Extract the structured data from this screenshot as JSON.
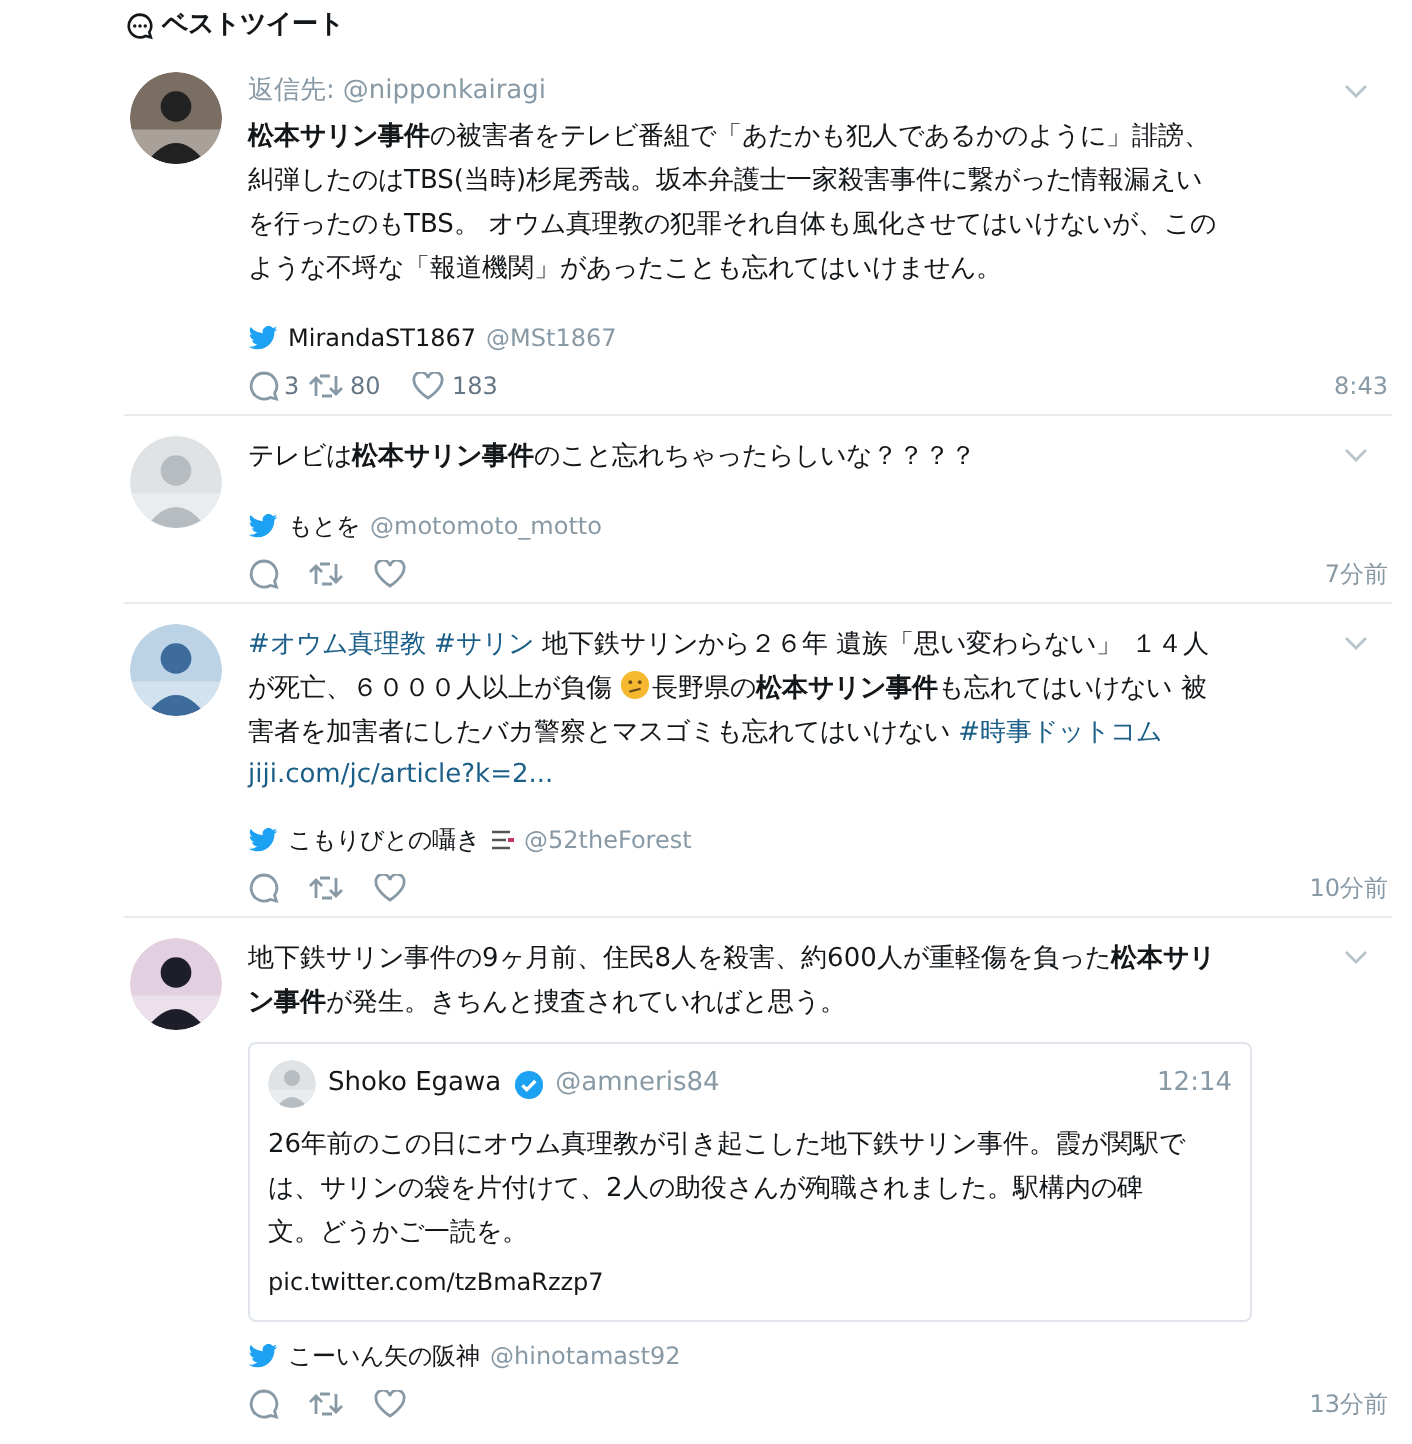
{
  "header": {
    "title": "ベストツイート"
  },
  "tweets": [
    {
      "reply_to": {
        "label": "返信先:",
        "handle": "@nipponkairagi"
      },
      "segments": [
        {
          "kind": "text",
          "text": "**松本サリン事件**の被害者をテレビ番組で「あたかも犯人であるかのように」誹謗、糾弾したのはTBS(当時)杉尾秀哉。坂本弁護士一家殺害事件に繋がった情報漏えいを行ったのもTBS。 オウム真理教の犯罪それ自体も風化させてはいけないが、このような不埒な「報道機関」があったことも忘れてはいけません。"
        }
      ],
      "author": {
        "name": "MirandaST1867",
        "handle": "@MSt1867"
      },
      "counts": {
        "replies": "3",
        "retweets": "80",
        "likes": "183"
      },
      "time": "8:43"
    },
    {
      "segments": [
        {
          "kind": "text",
          "text": "テレビは**松本サリン事件**のこと忘れちゃったらしいな？？？？"
        }
      ],
      "author": {
        "name": "もとを",
        "handle": "@motomoto_motto"
      },
      "time": "7分前"
    },
    {
      "segments": [
        {
          "kind": "hashtag",
          "text": "#オウム真理教"
        },
        {
          "kind": "hashtag",
          "text": "#サリン"
        },
        {
          "kind": "text",
          "text": " 地下鉄サリンから２６年 遺族「思い変わらない」 １４人が死亡、６０００人以上が負傷 "
        },
        {
          "kind": "emoji"
        },
        {
          "kind": "text",
          "text": "長野県の**松本サリン事件**も忘れてはいけない 被害者を加害者にしたバカ警察とマスゴミも忘れてはいけない "
        },
        {
          "kind": "hashtag",
          "text": "#時事ドットコム"
        }
      ],
      "link": "jiji.com/jc/article?k=2...",
      "author": {
        "name": "こもりびとの囁き",
        "handle": "@52theForest",
        "badge": true
      },
      "time": "10分前"
    },
    {
      "segments": [
        {
          "kind": "text",
          "text": "地下鉄サリン事件の9ヶ月前、住民8人を殺害、約600人が重軽傷を負った**松本サリン事件**が発生。きちんと捜査されていればと思う。"
        }
      ],
      "quote": {
        "name": "Shoko Egawa",
        "verified": true,
        "handle": "@amneris84",
        "time": "12:14",
        "text": "26年前のこの日にオウム真理教が引き起こした地下鉄サリン事件。霞が関駅では、サリンの袋を片付けて、2人の助役さんが殉職されました。駅構内の碑文。どうかご一読を。",
        "link": "pic.twitter.com/tzBmaRzzp7"
      },
      "author": {
        "name": "こーいん矢の阪神",
        "handle": "@hinotamast92"
      },
      "time": "13分前"
    }
  ]
}
